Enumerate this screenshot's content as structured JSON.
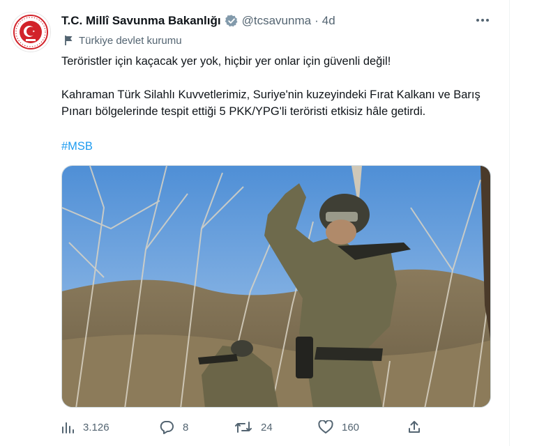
{
  "tweet": {
    "author_name": "T.C. Millî Savunma Bakanlığı",
    "handle": "@tcsavunma",
    "separator": "·",
    "time": "4d",
    "gov_label": "Türkiye devlet kurumu",
    "text": "Teröristler için kaçacak yer yok, hiçbir yer onlar için güvenli değil!\n\nKahraman Türk Silahlı Kuvvetlerimiz, Suriye'nin kuzeyindeki Fırat Kalkanı ve Barış Pınarı bölgelerinde tespit ettiği 5 PKK/YPG'li teröristi etkisiz hâle getirdi.",
    "hashtag": "#MSB"
  },
  "actions": {
    "views": "3.126",
    "replies": "8",
    "retweets": "24",
    "likes": "160"
  },
  "icons": {
    "verified": "verified-badge-icon",
    "gov": "flag-icon",
    "more": "more-icon",
    "views": "analytics-icon",
    "reply": "reply-icon",
    "retweet": "retweet-icon",
    "like": "heart-icon",
    "share": "share-icon"
  },
  "colors": {
    "text": "#0f1419",
    "muted": "#536471",
    "link": "#1d9bf0",
    "avatar_red": "#d2232a"
  }
}
